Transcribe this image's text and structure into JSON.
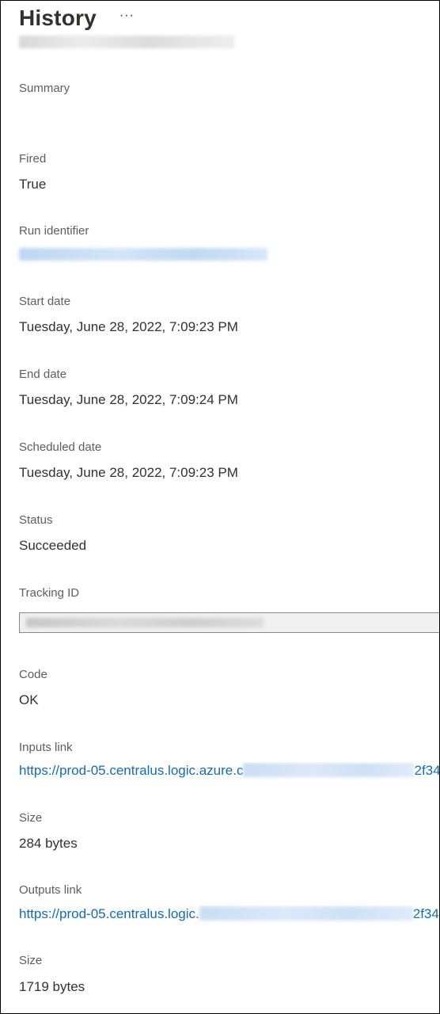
{
  "header": {
    "title": "History",
    "more_label": "···"
  },
  "fields": {
    "summary": {
      "label": "Summary",
      "value": ""
    },
    "fired": {
      "label": "Fired",
      "value": "True"
    },
    "run_identifier": {
      "label": "Run identifier"
    },
    "start_date": {
      "label": "Start date",
      "value": "Tuesday, June 28, 2022, 7:09:23 PM"
    },
    "end_date": {
      "label": "End date",
      "value": "Tuesday, June 28, 2022, 7:09:24 PM"
    },
    "scheduled_date": {
      "label": "Scheduled date",
      "value": "Tuesday, June 28, 2022, 7:09:23 PM"
    },
    "status": {
      "label": "Status",
      "value": "Succeeded"
    },
    "tracking_id": {
      "label": "Tracking ID"
    },
    "code": {
      "label": "Code",
      "value": "OK"
    },
    "inputs_link": {
      "label": "Inputs link",
      "prefix": "https://prod-05.centralus.logic.azure.c",
      "suffix": "2f34"
    },
    "inputs_size": {
      "label": "Size",
      "value": "284 bytes"
    },
    "outputs_link": {
      "label": "Outputs link",
      "prefix": "https://prod-05.centralus.logic.",
      "suffix": "2f34"
    },
    "outputs_size": {
      "label": "Size",
      "value": "1719 bytes"
    }
  },
  "colors": {
    "link": "#0f6cbd",
    "label": "#605e5c",
    "text": "#323130"
  }
}
